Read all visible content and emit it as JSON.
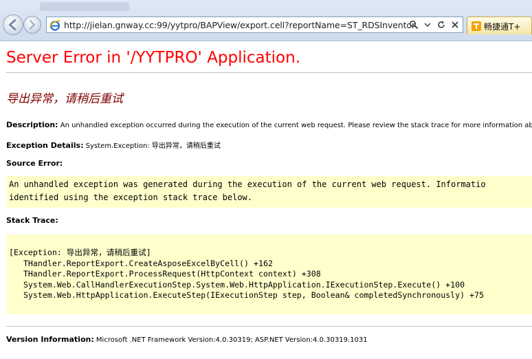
{
  "browser": {
    "url": "http://jielan.gnway.cc:99/yytpro/BAPView/export.cell?reportName=ST_RDSInventoryTota",
    "tab_label": "畅捷通T+"
  },
  "page": {
    "title": "Server Error in '/YYTPRO' Application.",
    "error_message": "导出异常，请稍后重试",
    "description_label": "Description:",
    "description_text": "An unhandled exception occurred during the execution of the current web request. Please review the stack trace for more information about t",
    "exception_label": "Exception Details:",
    "exception_text": "System.Exception: 导出异常，请稍后重试",
    "source_error_label": "Source Error:",
    "source_error_lines": [
      "An unhandled exception was generated during the execution of the current web request. Informatio",
      "identified using the exception stack trace below."
    ],
    "stack_trace_label": "Stack Trace:",
    "stack_trace_lines": [
      "[Exception: 导出异常，请稍后重试]",
      "   THandler.ReportExport.CreateAsposeExcelByCell() +162",
      "   THandler.ReportExport.ProcessRequest(HttpContext context) +308",
      "   System.Web.CallHandlerExecutionStep.System.Web.HttpApplication.IExecutionStep.Execute() +100",
      "   System.Web.HttpApplication.ExecuteStep(IExecutionStep step, Boolean& completedSynchronously) +75"
    ],
    "version_label": "Version Information:",
    "version_text": "Microsoft .NET Framework Version:4.0.30319; ASP.NET Version:4.0.30319.1031"
  },
  "colors": {
    "title": "#ff0000",
    "error_message": "#800000",
    "code_background": "#ffffcc"
  },
  "icons": [
    "back-icon",
    "forward-icon",
    "ie-icon",
    "search-icon",
    "refresh-icon",
    "close-icon",
    "tab-favicon"
  ]
}
